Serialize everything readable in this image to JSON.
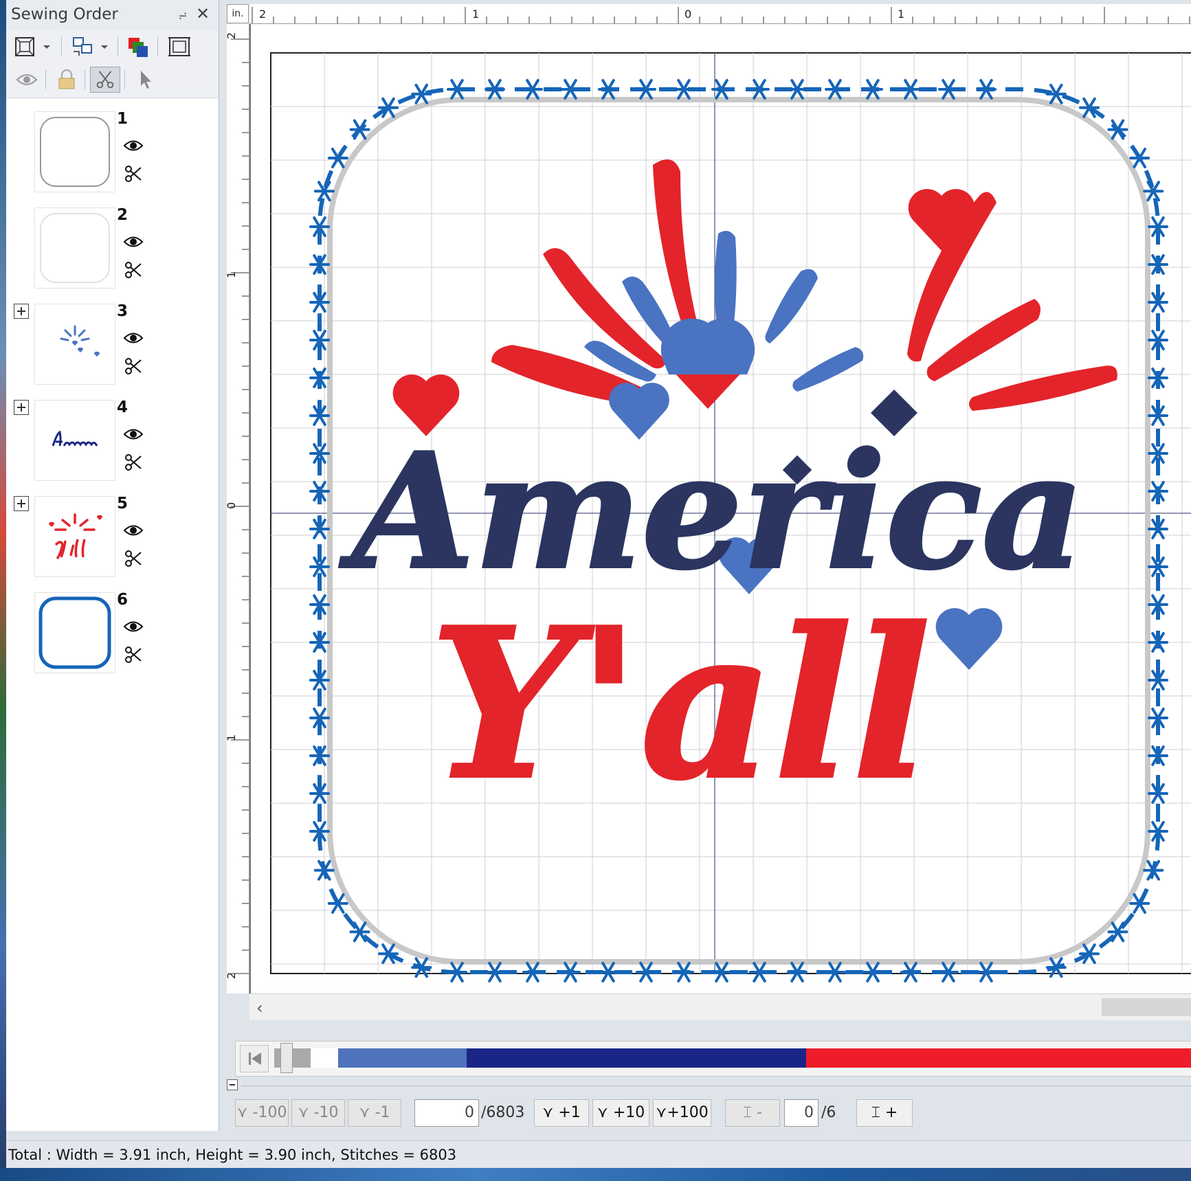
{
  "sewing_order": {
    "title": "Sewing Order",
    "toolbar_row1": [
      "fit-view-icon",
      "group-icon",
      "color-layers-icon",
      "hoop-icon"
    ],
    "toolbar_row2": [
      "eye-icon",
      "lock-icon",
      "scissors-icon",
      "pointer-icon"
    ],
    "layers": [
      {
        "number": "1",
        "expandable": false,
        "thumbnail": "rounded-square-outline-gray"
      },
      {
        "number": "2",
        "expandable": false,
        "thumbnail": "rounded-square-outline-light"
      },
      {
        "number": "3",
        "expandable": true,
        "thumbnail": "blue-burst-hearts"
      },
      {
        "number": "4",
        "expandable": true,
        "thumbnail": "navy-america-text"
      },
      {
        "number": "5",
        "expandable": true,
        "thumbnail": "red-burst-yall"
      },
      {
        "number": "6",
        "expandable": false,
        "thumbnail": "rounded-square-outline-blue"
      }
    ]
  },
  "ruler": {
    "unit": "in.",
    "h_labels": [
      "2",
      "1",
      "0",
      "1"
    ],
    "v_labels": [
      "2",
      "1",
      "0",
      "1",
      "2"
    ]
  },
  "design": {
    "line1": "America",
    "line2": "Y'all",
    "colors": {
      "navy": "#2b3560",
      "red": "#e3242b",
      "light_blue": "#4a73c2",
      "border_blue": "#1565b8",
      "grid": "#cfcfcf"
    }
  },
  "timeline": {
    "segments": [
      {
        "color": "#a9a9a9",
        "fraction": 0.04
      },
      {
        "color": "#ffffff",
        "fraction": 0.03
      },
      {
        "color": "#4f73bd",
        "fraction": 0.14
      },
      {
        "color": "#1a2685",
        "fraction": 0.37
      },
      {
        "color": "#ef1c2c",
        "fraction": 0.42
      }
    ]
  },
  "navigation": {
    "back100": "-100",
    "back10": "-10",
    "back1": "-1",
    "stitch_current": "0",
    "stitch_total": "/6803",
    "fwd1": "+1",
    "fwd10": "+10",
    "fwd100": "+100",
    "color_prev": "-",
    "color_current": "0",
    "color_total": "/6",
    "color_next": "+"
  },
  "status": "Total : Width = 3.91 inch, Height = 3.90 inch, Stitches = 6803"
}
